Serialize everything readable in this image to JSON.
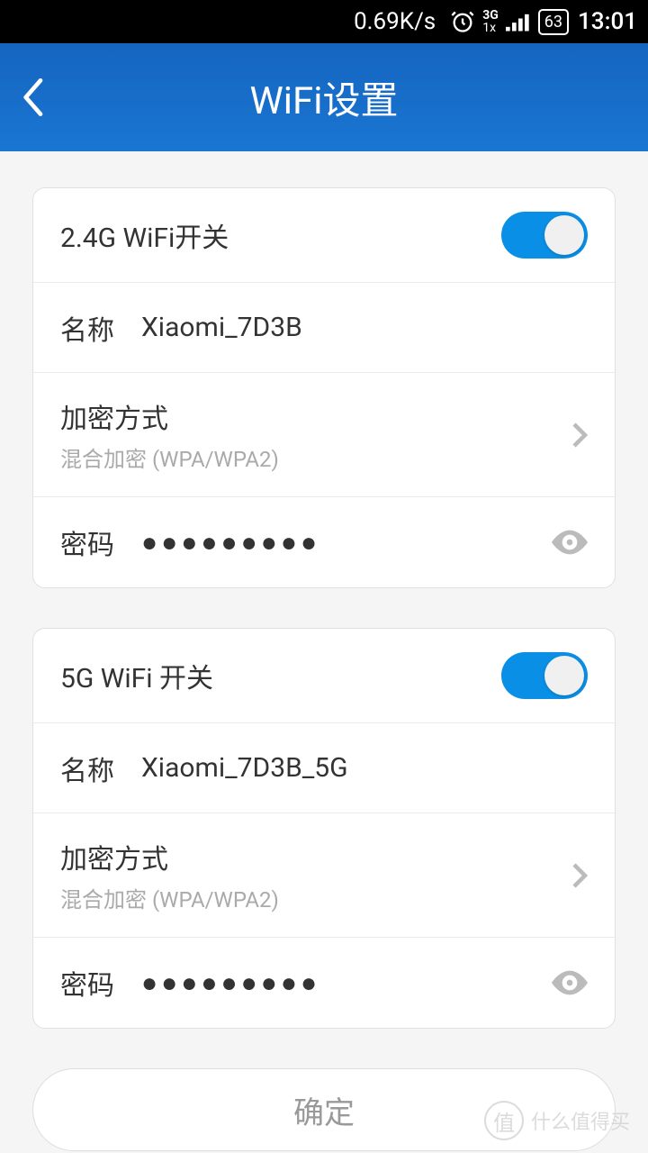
{
  "status": {
    "speed": "0.69K/s",
    "network": "3G",
    "network2": "1x",
    "battery": "63",
    "time": "13:01"
  },
  "header": {
    "title": "WiFi设置"
  },
  "wifi24": {
    "toggle_label": "2.4G WiFi开关",
    "name_label": "名称",
    "name_value": "Xiaomi_7D3B",
    "encrypt_label": "加密方式",
    "encrypt_value": "混合加密 (WPA/WPA2)",
    "password_label": "密码",
    "password_value": "●●●●●●●●●"
  },
  "wifi5": {
    "toggle_label": "5G WiFi 开关",
    "name_label": "名称",
    "name_value": "Xiaomi_7D3B_5G",
    "encrypt_label": "加密方式",
    "encrypt_value": "混合加密 (WPA/WPA2)",
    "password_label": "密码",
    "password_value": "●●●●●●●●●"
  },
  "confirm": "确定",
  "watermark": {
    "badge": "值",
    "text": "什么值得买"
  }
}
